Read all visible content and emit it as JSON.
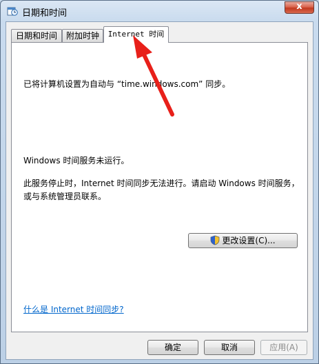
{
  "window": {
    "title": "日期和时间",
    "close_glyph": "x"
  },
  "tabs": [
    {
      "label": "日期和时间",
      "active": false
    },
    {
      "label": "附加时钟",
      "active": false
    },
    {
      "label": "Internet 时间",
      "active": true
    }
  ],
  "panel": {
    "sync_info": "已将计算机设置为自动与 “time.windows.com” 同步。",
    "service_status": "Windows 时间服务未运行。",
    "service_hint_line1": "此服务停止时，Internet 时间同步无法进行。请启动 Windows 时间服务，",
    "service_hint_line2": "或与系统管理员联系。",
    "change_settings_label": "更改设置(C)...",
    "help_link": "什么是 Internet 时间同步?"
  },
  "footer": {
    "ok_label": "确定",
    "cancel_label": "取消",
    "apply_label": "应用(A)"
  },
  "colors": {
    "link": "#0066cc",
    "arrow": "#e8201a",
    "close_button": "#c2391f"
  }
}
